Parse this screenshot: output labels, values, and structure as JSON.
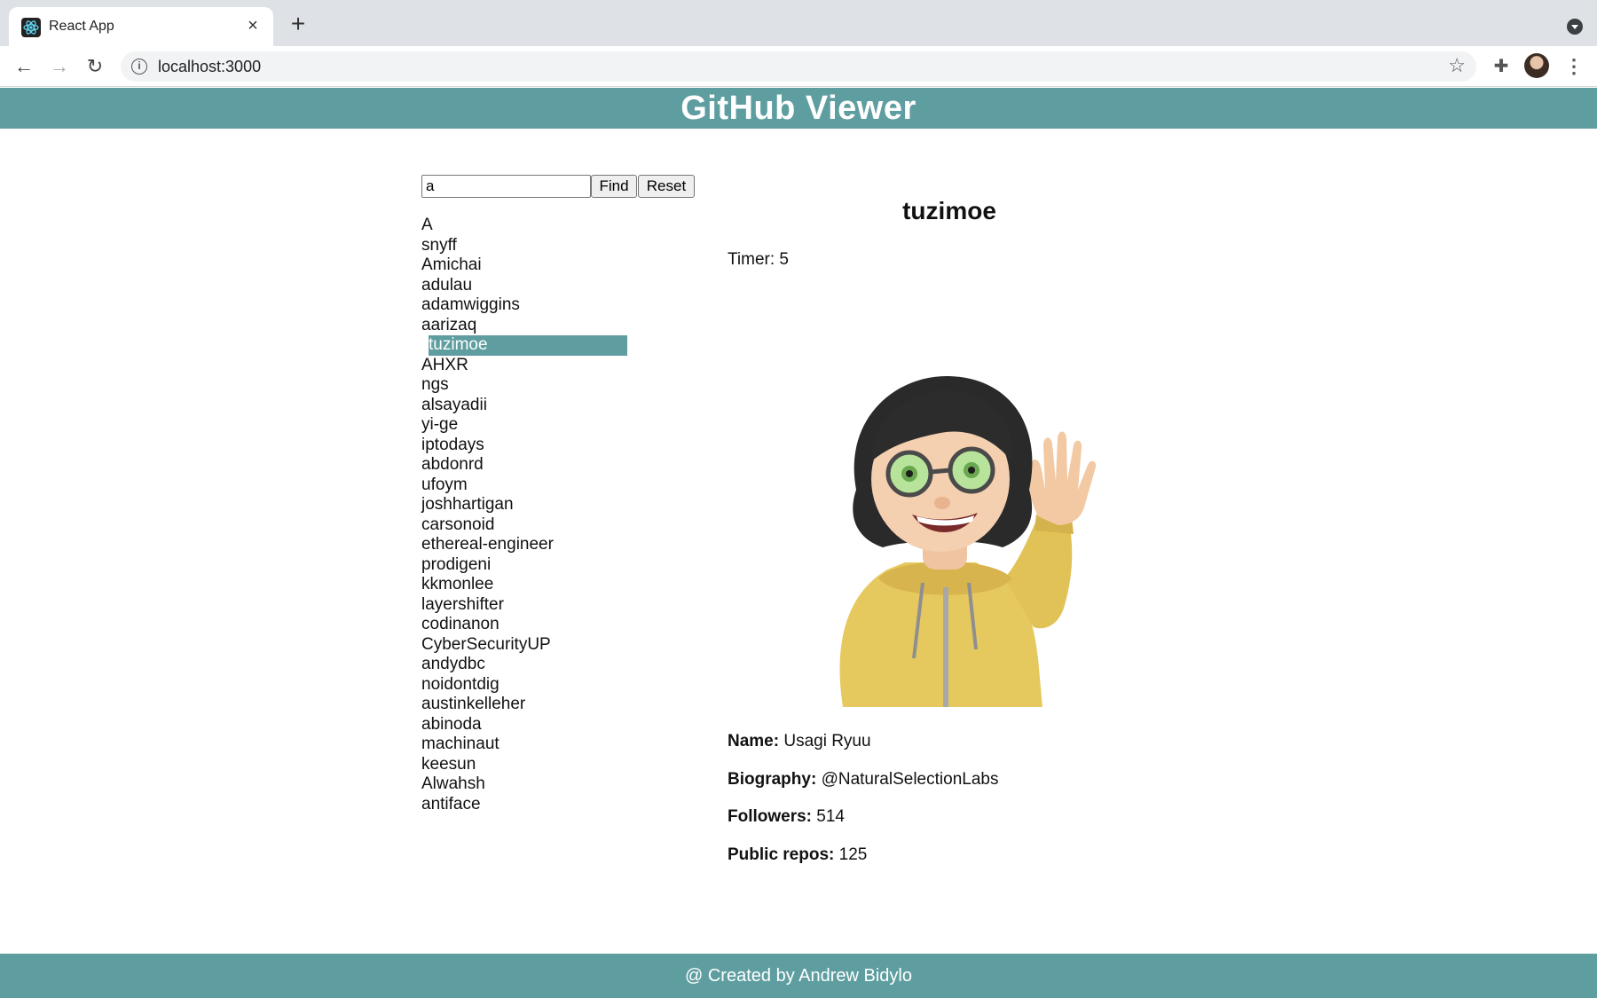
{
  "browser": {
    "tab_title": "React App",
    "tab_close_icon": "×",
    "new_tab_icon": "+",
    "url": "localhost:3000",
    "back_icon": "←",
    "forward_icon": "→",
    "reload_icon": "↻",
    "info_icon": "i",
    "star_icon": "☆",
    "extensions_icon": "✚",
    "menu_icon": "⋮"
  },
  "header": {
    "title": "GitHub Viewer"
  },
  "search": {
    "value": "a",
    "find_label": "Find",
    "reset_label": "Reset"
  },
  "users": [
    "A",
    "snyff",
    "Amichai",
    "adulau",
    "adamwiggins",
    "aarizaq",
    "tuzimoe",
    "AHXR",
    "ngs",
    "alsayadii",
    "yi-ge",
    "iptodays",
    "abdonrd",
    "ufoym",
    "joshhartigan",
    "carsonoid",
    "ethereal-engineer",
    "prodigeni",
    "kkmonlee",
    "layershifter",
    "codinanon",
    "CyberSecurityUP",
    "andydbc",
    "noidontdig",
    "austinkelleher",
    "abinoda",
    "machinaut",
    "keesun",
    "Alwahsh",
    "antiface"
  ],
  "selected_user": "tuzimoe",
  "profile": {
    "login": "tuzimoe",
    "timer_label": "Timer: 5",
    "name_label": "Name:",
    "name": "Usagi Ryuu",
    "bio_label": "Biography:",
    "bio": "@NaturalSelectionLabs",
    "followers_label": "Followers:",
    "followers": "514",
    "repos_label": "Public repos:",
    "repos": "125"
  },
  "footer": {
    "text": "@ Created by Andrew Bidylo"
  },
  "colors": {
    "accent": "#5f9ea0",
    "chrome": "#dee1e6"
  }
}
